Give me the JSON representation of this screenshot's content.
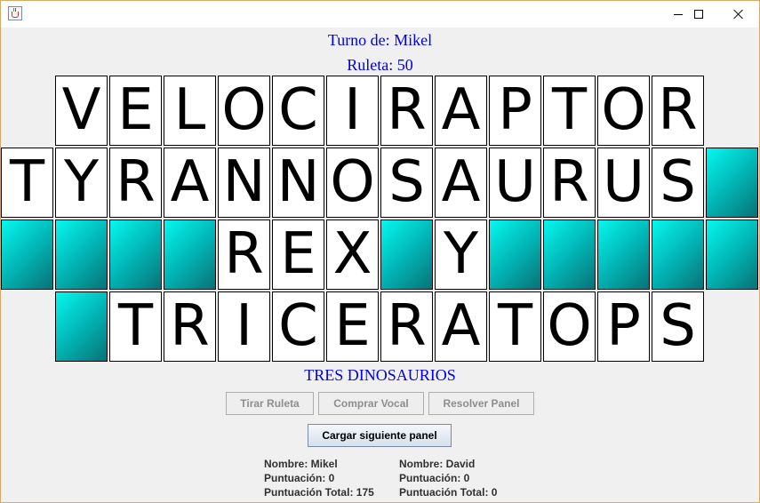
{
  "window": {
    "icon": "java-cup-icon",
    "controls": [
      "minimize-icon",
      "maximize-icon",
      "close-icon"
    ]
  },
  "game": {
    "turn_text": "Turno de: Mikel",
    "wheel_text": "Ruleta: 50",
    "clue": "TRES DINOSAURIOS",
    "board": [
      [
        "",
        "V",
        "E",
        "L",
        "O",
        "C",
        "I",
        "R",
        "A",
        "P",
        "T",
        "O",
        "R",
        ""
      ],
      [
        "T",
        "Y",
        "R",
        "A",
        "N",
        "N",
        "O",
        "S",
        "A",
        "U",
        "R",
        "U",
        "S",
        "#"
      ],
      [
        "#",
        "#",
        "#",
        "#",
        "R",
        "E",
        "X",
        "#",
        "Y",
        "#",
        "#",
        "#",
        "#",
        "#"
      ],
      [
        "",
        "#",
        "T",
        "R",
        "I",
        "C",
        "E",
        "R",
        "A",
        "T",
        "O",
        "P",
        "S",
        ""
      ]
    ],
    "board_legend": {
      "#": "empty-cyan-tile",
      "": "no-tile"
    }
  },
  "actions": {
    "spin": "Tirar Ruleta",
    "buy_vowel": "Comprar Vocal",
    "solve": "Resolver Panel",
    "next_panel": "Cargar siguiente panel"
  },
  "players": [
    {
      "name_line": "Nombre: Mikel",
      "score_line": "Puntuación: 0",
      "total_line": "Puntuación Total: 175"
    },
    {
      "name_line": "Nombre: David",
      "score_line": "Puntuación: 0",
      "total_line": "Puntuación Total: 0"
    }
  ]
}
